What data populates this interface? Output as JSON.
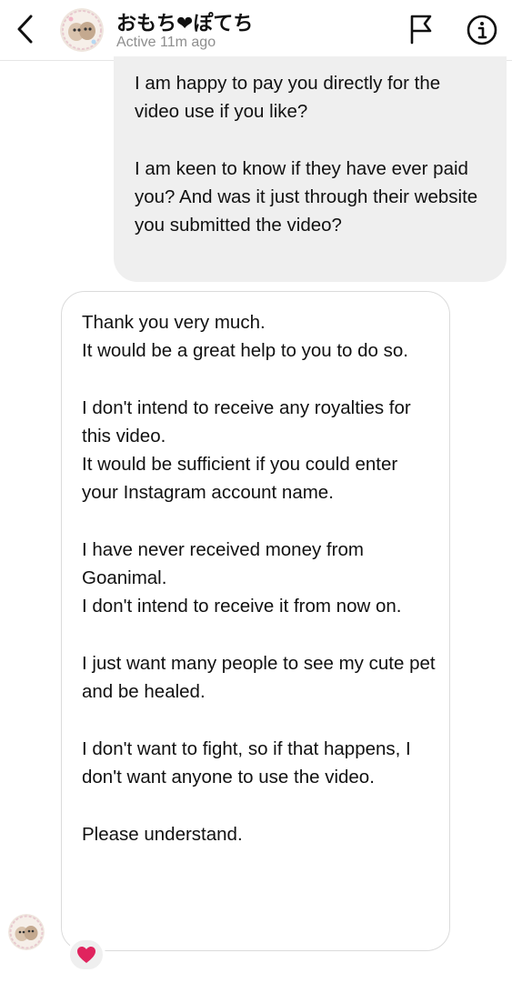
{
  "header": {
    "contact_name": "おもち❤ぽてち",
    "status": "Active 11m ago",
    "back_icon": "chevron-left-icon",
    "flag_icon": "flag-icon",
    "info_icon": "info-icon"
  },
  "messages": {
    "outgoing": {
      "paragraphs": [
        "I am happy to pay you directly for the video use if you like?",
        "I am keen to know if they have ever paid you? And was it just through their website you submitted the video?"
      ]
    },
    "incoming": {
      "paragraphs": [
        [
          "Thank you very much.",
          "It would be a great help to you to do so."
        ],
        [
          "I don't intend to receive any royalties for this video.",
          "It would be sufficient if you could enter your Instagram account name."
        ],
        [
          "I have never received money from Goanimal.",
          "I don't intend to receive it from now on."
        ],
        [
          "I just want many people to see my cute pet and be healed."
        ],
        [
          "I don't want to fight, so if that happens, I don't want anyone to use the video."
        ],
        [
          "Please understand."
        ]
      ],
      "reaction": "❤️"
    }
  },
  "colors": {
    "outgoing_bubble": "#efefef",
    "incoming_border": "#dbdbdb",
    "status_text": "#8e8e8e",
    "reaction_heart": "#e0245e"
  }
}
